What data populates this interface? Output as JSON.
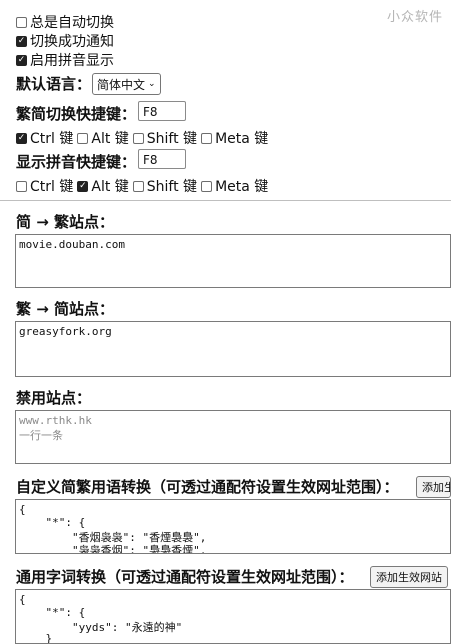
{
  "watermark": "小众软件",
  "general": {
    "always_auto_switch": {
      "label": "总是自动切换",
      "checked": false
    },
    "notify_success": {
      "label": "切换成功通知",
      "checked": true
    },
    "enable_pinyin": {
      "label": "启用拼音显示",
      "checked": true
    }
  },
  "language": {
    "label": "默认语言：",
    "selected": "简体中文"
  },
  "toggle_hotkey": {
    "label": "繁简切换快捷键：",
    "key": "F8",
    "modifiers": [
      {
        "label": "Ctrl 键",
        "checked": true
      },
      {
        "label": "Alt 键",
        "checked": false
      },
      {
        "label": "Shift 键",
        "checked": false
      },
      {
        "label": "Meta 键",
        "checked": false
      }
    ]
  },
  "pinyin_hotkey": {
    "label": "显示拼音快捷键：",
    "key": "F8",
    "modifiers": [
      {
        "label": "Ctrl 键",
        "checked": false
      },
      {
        "label": "Alt 键",
        "checked": true
      },
      {
        "label": "Shift 键",
        "checked": false
      },
      {
        "label": "Meta 键",
        "checked": false
      }
    ]
  },
  "s2t_sites": {
    "title": "简 → 繁站点：",
    "value": "movie.douban.com"
  },
  "t2s_sites": {
    "title": "繁 → 简站点：",
    "value": "greasyfork.org"
  },
  "disabled_sites": {
    "title": "禁用站点：",
    "placeholder_line1": "www.rthk.hk",
    "placeholder_line2": "一行一条"
  },
  "custom_phrases": {
    "title": "自定义简繁用语转换（可透过通配符设置生效网址范围）：",
    "button": "添加生效网址",
    "lines": [
      "{",
      "    \"*\": {",
      "        \"香烟袅袅\": \"香煙裊裊\",",
      "        \"袅袅香烟\": \"裊裊香煙\","
    ]
  },
  "common_words": {
    "title": "通用字词转换（可透过通配符设置生效网址范围）：",
    "button": "添加生效网站",
    "lines": [
      "{",
      "    \"*\": {",
      "        \"yyds\": \"永遠的神\"",
      "    }"
    ]
  }
}
